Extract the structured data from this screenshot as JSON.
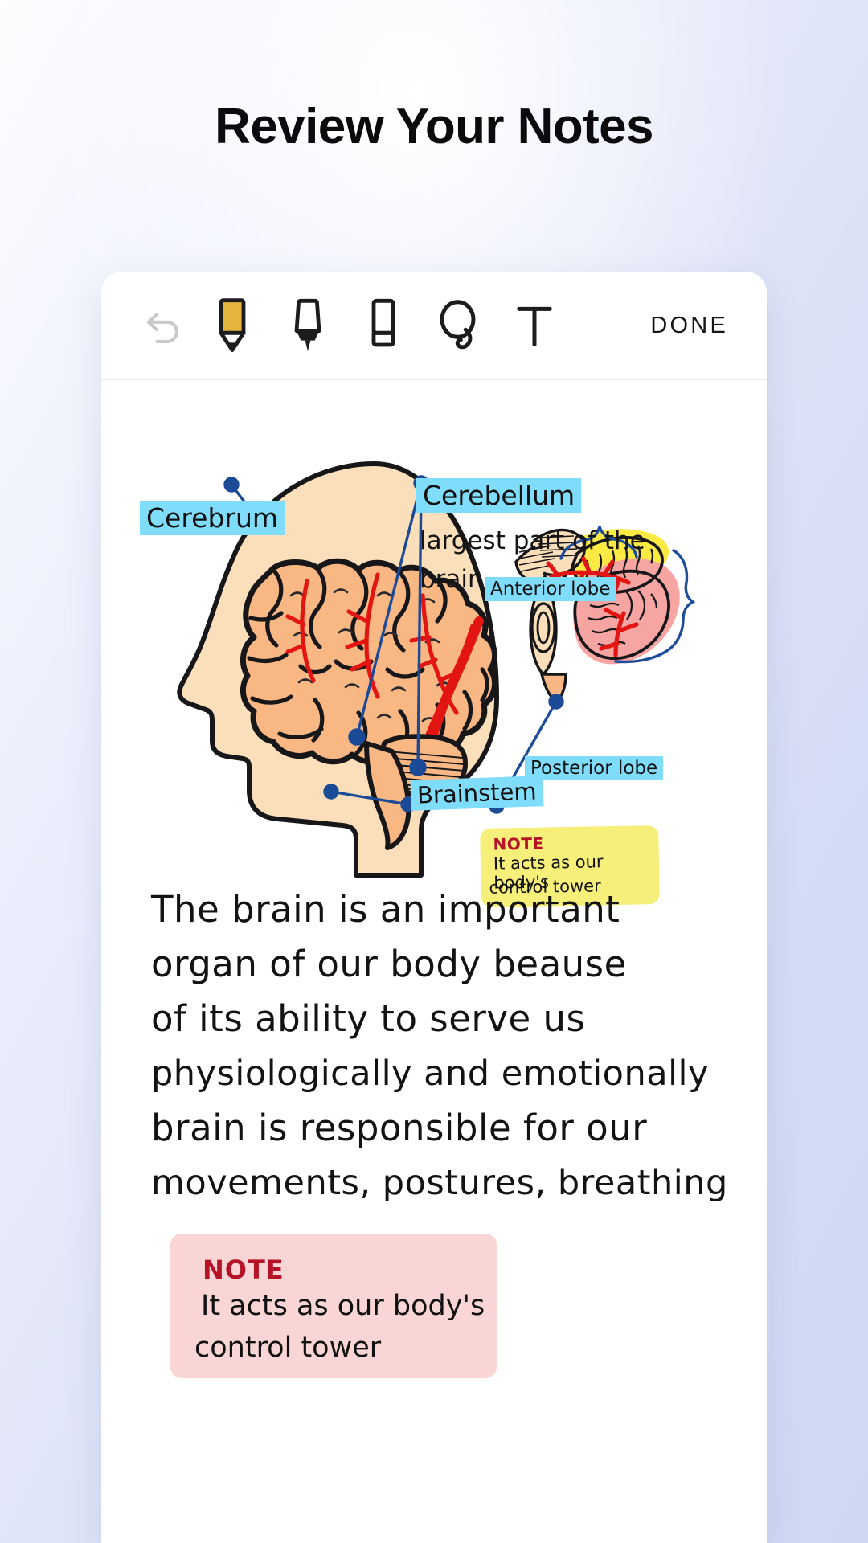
{
  "page": {
    "title": "Review Your Notes",
    "background_color": "#d5dcf5",
    "card_background": "#ffffff"
  },
  "toolbar": {
    "items": [
      {
        "icon": "undo-icon",
        "name": "undo-button",
        "label": "Undo",
        "state": "disabled"
      },
      {
        "icon": "pencil-icon",
        "name": "pencil-tool",
        "label": "Pencil",
        "state": "selected",
        "color": "#e3b53f"
      },
      {
        "icon": "pen-icon",
        "name": "pen-tool",
        "label": "Pen",
        "state": "normal"
      },
      {
        "icon": "eraser-icon",
        "name": "eraser-tool",
        "label": "Eraser",
        "state": "normal"
      },
      {
        "icon": "lasso-icon",
        "name": "lasso-tool",
        "label": "Lasso",
        "state": "normal"
      },
      {
        "icon": "text-icon",
        "name": "text-tool",
        "label": "Text",
        "state": "normal"
      }
    ],
    "done_label": "DONE"
  },
  "note": {
    "highlight_color": "#7fdcfb",
    "annotations": [
      {
        "name": "label-cerebrum",
        "text": "Cerebrum",
        "highlighted": true
      },
      {
        "name": "label-cerebellum",
        "text": "Cerebellum",
        "highlighted": true
      },
      {
        "name": "label-anterior-lobe",
        "text": "Anterior lobe",
        "highlighted": true
      },
      {
        "name": "label-posterior-lobe",
        "text": "Posterior lobe",
        "highlighted": true
      },
      {
        "name": "label-brainstem",
        "text": "Brainstem",
        "highlighted": true
      }
    ],
    "cerebellum_caption": {
      "line1": "largest part of the",
      "line2": "brain."
    },
    "sticky_yellow": {
      "color": "#f6ef7a",
      "heading": "NOTE",
      "heading_color": "#b51226",
      "line1": "It acts as our body's",
      "line2": "control tower"
    },
    "sticky_pink": {
      "color": "#fad5d5",
      "heading": "NOTE",
      "heading_color": "#b51226",
      "line1": "It acts as our body's",
      "line2": "control tower"
    },
    "body_lines": [
      "The brain is an important",
      "organ of our body beause",
      "of its ability to serve us",
      "physiologically and emotionally",
      "brain is responsible for our",
      "movements, postures, breathing"
    ]
  }
}
